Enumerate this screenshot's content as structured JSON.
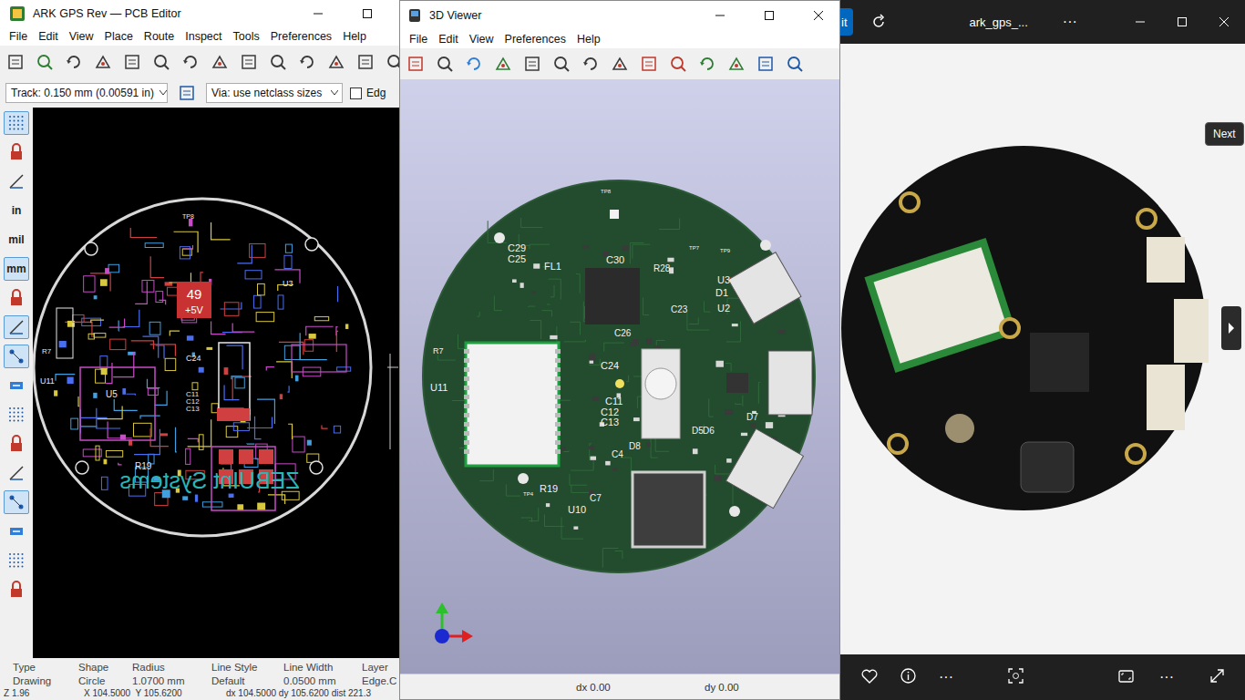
{
  "pcb_editor": {
    "title": "ARK GPS Rev — PCB Editor",
    "menu": [
      "File",
      "Edit",
      "View",
      "Place",
      "Route",
      "Inspect",
      "Tools",
      "Preferences",
      "Help"
    ],
    "track_select": "Track: 0.150 mm (0.00591 in)",
    "via_select": "Via: use netclass sizes",
    "layer_toggle": {
      "label": "Edg",
      "checked": false
    },
    "left_tools": [
      {
        "kind": "icon",
        "selected": true
      },
      {
        "kind": "icon",
        "selected": false
      },
      {
        "kind": "icon",
        "selected": false
      },
      {
        "kind": "text",
        "label": "in",
        "selected": false
      },
      {
        "kind": "text",
        "label": "mil",
        "selected": false
      },
      {
        "kind": "text",
        "label": "mm",
        "selected": true
      },
      {
        "kind": "icon",
        "selected": false
      },
      {
        "kind": "icon",
        "selected": true
      },
      {
        "kind": "icon",
        "selected": true
      },
      {
        "kind": "icon",
        "selected": false
      },
      {
        "kind": "icon",
        "selected": false
      },
      {
        "kind": "icon",
        "selected": false
      },
      {
        "kind": "icon",
        "selected": false
      },
      {
        "kind": "icon",
        "selected": true
      },
      {
        "kind": "icon",
        "selected": false
      },
      {
        "kind": "icon",
        "selected": false
      },
      {
        "kind": "icon",
        "selected": false
      }
    ],
    "net_badge": {
      "number": "49",
      "net": "+5V"
    },
    "board_labels": [
      "C24",
      "U5",
      "C11",
      "C12",
      "C13",
      "R19",
      "R7",
      "U11",
      "U3",
      "TP8"
    ],
    "silkscreen": "ZEBUInt Systems",
    "status_fields": [
      {
        "label": "Type",
        "value": "Drawing"
      },
      {
        "label": "Shape",
        "value": "Circle"
      },
      {
        "label": "Radius",
        "value": "1.0700 mm"
      },
      {
        "label": "Line Style",
        "value": "Default"
      },
      {
        "label": "Line Width",
        "value": "0.0500 mm"
      },
      {
        "label": "Layer",
        "value": "Edge.C"
      }
    ],
    "footer": [
      "Z 1.96",
      "X 104.5000  Y 105.6200",
      "dx 104.5000 dy 105.6200 dist 221.3"
    ]
  },
  "viewer_3d": {
    "title": "3D Viewer",
    "menu": [
      "File",
      "Edit",
      "View",
      "Preferences",
      "Help"
    ],
    "labels": [
      "TP8",
      "C29",
      "C25",
      "FL1",
      "C30",
      "R28",
      "TP7",
      "TP9",
      "U3",
      "D1",
      "U2",
      "C23",
      "C26",
      "R7",
      "U11",
      "C24",
      "C11",
      "C12",
      "C13",
      "D8",
      "C4",
      "R19",
      "TP4",
      "U10",
      "C7",
      "D5",
      "D6",
      "D7"
    ],
    "status": [
      "dx 0.00",
      "dy 0.00"
    ]
  },
  "photos": {
    "edit_button": "it",
    "title": "ark_gps_...",
    "title_more": "···",
    "tooltip": "Next",
    "bottom_more": [
      "···",
      "···"
    ]
  }
}
